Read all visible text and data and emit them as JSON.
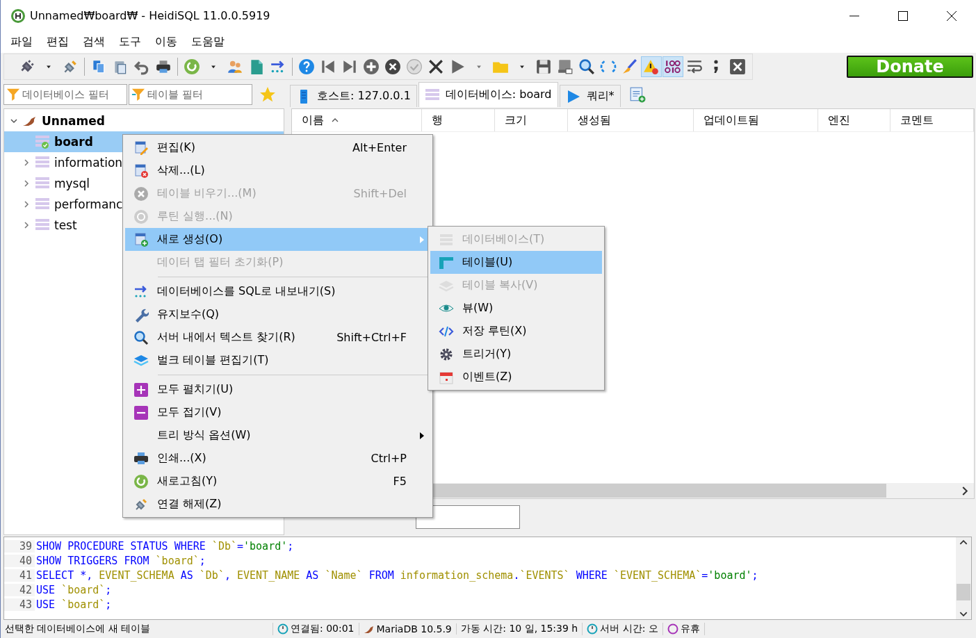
{
  "window": {
    "title": "Unnamed₩board₩ - HeidiSQL 11.0.0.5919"
  },
  "menu_bar": [
    "파일",
    "편집",
    "검색",
    "도구",
    "이동",
    "도움말"
  ],
  "toolbar": {
    "warning_toggle_on": true,
    "binary_toggle_on": true,
    "donate": "Donate"
  },
  "filters": {
    "database_placeholder": "데이터베이스 필터",
    "table_placeholder": "테이블 필터"
  },
  "tabs": [
    {
      "label": "호스트: 127.0.0.1",
      "selected": false
    },
    {
      "label": "데이터베이스: board",
      "selected": true
    },
    {
      "label": "쿼리*",
      "selected": false
    }
  ],
  "tree": {
    "label": "Unnamed",
    "expanded": true,
    "children": [
      {
        "label": "board",
        "selected": true,
        "expandable": false
      },
      {
        "label": "information",
        "selected": false,
        "expandable": true
      },
      {
        "label": "mysql",
        "selected": false,
        "expandable": true
      },
      {
        "label": "performanc",
        "selected": false,
        "expandable": true
      },
      {
        "label": "test",
        "selected": false,
        "expandable": true
      }
    ]
  },
  "table": {
    "columns": [
      {
        "label": "이름",
        "sorted": true
      },
      {
        "label": "행",
        "sorted": false
      },
      {
        "label": "크기",
        "sorted": false
      },
      {
        "label": "생성됨",
        "sorted": false
      },
      {
        "label": "업데이트됨",
        "sorted": false
      },
      {
        "label": "엔진",
        "sorted": false
      },
      {
        "label": "코멘트",
        "sorted": false
      }
    ]
  },
  "context_menu": [
    {
      "label": "편집(K)",
      "shortcut": "Alt+Enter",
      "disabled": false,
      "selected": false,
      "submenu": false,
      "separator_before": false
    },
    {
      "label": "삭제...(L)",
      "disabled": false,
      "selected": false,
      "submenu": false,
      "separator_before": false
    },
    {
      "label": "테이블 비우기...(M)",
      "shortcut": "Shift+Del",
      "disabled": true,
      "selected": false,
      "submenu": false,
      "separator_before": false
    },
    {
      "label": "루틴 실행...(N)",
      "disabled": true,
      "selected": false,
      "submenu": false,
      "separator_before": false
    },
    {
      "label": "새로 생성(O)",
      "disabled": false,
      "selected": true,
      "submenu": true,
      "separator_before": false
    },
    {
      "label": "데이터 탭 필터 초기화(P)",
      "disabled": true,
      "selected": false,
      "submenu": false,
      "separator_before": false
    },
    {
      "label": "데이터베이스를 SQL로 내보내기(S)",
      "disabled": false,
      "selected": false,
      "submenu": false,
      "separator_before": true
    },
    {
      "label": "유지보수(Q)",
      "disabled": false,
      "selected": false,
      "submenu": false,
      "separator_before": false
    },
    {
      "label": "서버 내에서 텍스트 찾기(R)",
      "shortcut": "Shift+Ctrl+F",
      "disabled": false,
      "selected": false,
      "submenu": false,
      "separator_before": false
    },
    {
      "label": "벌크 테이블 편집기(T)",
      "disabled": false,
      "selected": false,
      "submenu": false,
      "separator_before": false
    },
    {
      "label": "모두 펼치기(U)",
      "disabled": false,
      "selected": false,
      "submenu": false,
      "separator_before": true
    },
    {
      "label": "모두 접기(V)",
      "disabled": false,
      "selected": false,
      "submenu": false,
      "separator_before": false
    },
    {
      "label": "트리 방식 옵션(W)",
      "disabled": false,
      "selected": false,
      "submenu": true,
      "separator_before": false
    },
    {
      "label": "인쇄...(X)",
      "shortcut": "Ctrl+P",
      "disabled": false,
      "selected": false,
      "submenu": false,
      "separator_before": false
    },
    {
      "label": "새로고침(Y)",
      "shortcut": "F5",
      "disabled": false,
      "selected": false,
      "submenu": false,
      "separator_before": false
    },
    {
      "label": "연결 해제(Z)",
      "disabled": false,
      "selected": false,
      "submenu": false,
      "separator_before": false
    }
  ],
  "submenu": [
    {
      "label": "데이터베이스(T)",
      "disabled": true,
      "selected": false
    },
    {
      "label": "테이블(U)",
      "disabled": false,
      "selected": true
    },
    {
      "label": "테이블 복사(V)",
      "disabled": true,
      "selected": false
    },
    {
      "label": "뷰(W)",
      "disabled": false,
      "selected": false
    },
    {
      "label": "저장 루틴(X)",
      "disabled": false,
      "selected": false
    },
    {
      "label": "트리거(Y)",
      "disabled": false,
      "selected": false
    },
    {
      "label": "이벤트(Z)",
      "disabled": false,
      "selected": false
    }
  ],
  "sql_log": [
    {
      "number": "39",
      "tokens": [
        {
          "kind": "keyword",
          "text": "SHOW PROCEDURE STATUS WHERE"
        },
        {
          "kind": "ident",
          "text": " `Db`"
        },
        {
          "kind": "punct",
          "text": "="
        },
        {
          "kind": "string",
          "text": "'board'"
        },
        {
          "kind": "punct",
          "text": ";"
        }
      ]
    },
    {
      "number": "40",
      "tokens": [
        {
          "kind": "keyword",
          "text": "SHOW TRIGGERS FROM"
        },
        {
          "kind": "ident",
          "text": " `board`"
        },
        {
          "kind": "punct",
          "text": ";"
        }
      ]
    },
    {
      "number": "41",
      "tokens": [
        {
          "kind": "keyword",
          "text": "SELECT"
        },
        {
          "kind": "punct",
          "text": " *, "
        },
        {
          "kind": "ident",
          "text": "EVENT_SCHEMA"
        },
        {
          "kind": "keyword",
          "text": " AS"
        },
        {
          "kind": "ident",
          "text": " `Db`"
        },
        {
          "kind": "punct",
          "text": ", "
        },
        {
          "kind": "ident",
          "text": "EVENT_NAME"
        },
        {
          "kind": "keyword",
          "text": " AS"
        },
        {
          "kind": "ident",
          "text": " `Name`"
        },
        {
          "kind": "keyword",
          "text": " FROM"
        },
        {
          "kind": "ident",
          "text": " information_schema"
        },
        {
          "kind": "punct",
          "text": "."
        },
        {
          "kind": "ident",
          "text": "`EVENTS`"
        },
        {
          "kind": "keyword",
          "text": " WHERE"
        },
        {
          "kind": "ident",
          "text": " `EVENT_SCHEMA`"
        },
        {
          "kind": "punct",
          "text": "="
        },
        {
          "kind": "string",
          "text": "'board'"
        },
        {
          "kind": "punct",
          "text": ";"
        }
      ]
    },
    {
      "number": "42",
      "tokens": [
        {
          "kind": "keyword",
          "text": "USE"
        },
        {
          "kind": "ident",
          "text": " `board`"
        },
        {
          "kind": "punct",
          "text": ";"
        }
      ]
    },
    {
      "number": "43",
      "tokens": [
        {
          "kind": "keyword",
          "text": "USE"
        },
        {
          "kind": "ident",
          "text": " `board`"
        },
        {
          "kind": "punct",
          "text": ";"
        }
      ]
    }
  ],
  "status_bar": [
    "선택한 데이터베이스에 새 테이블",
    "연결됨: 00:01",
    "MariaDB 10.5.9",
    "가동 시간: 10 일, 15:39 h",
    "서버 시간: 오",
    "유휴"
  ]
}
